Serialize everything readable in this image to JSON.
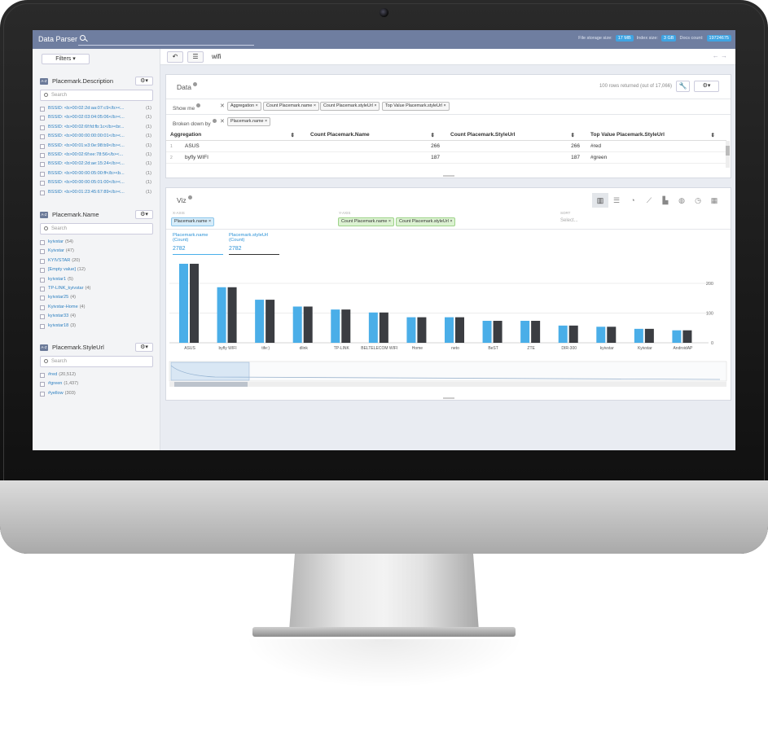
{
  "app": {
    "title": "Data Parser",
    "stats": [
      {
        "label": "File storage size:",
        "value": "17 MB"
      },
      {
        "label": "Index size:",
        "value": "3 GB"
      },
      {
        "label": "Docs count:",
        "value": "19724675"
      }
    ]
  },
  "sidebar": {
    "filters_label": "Filters ▾",
    "sections": [
      {
        "title": "Placemark.Description",
        "search_placeholder": "Search",
        "items": [
          {
            "label": "BSSID: <b>00:02:2d:aa:07:c9</b><...",
            "count": "(1)"
          },
          {
            "label": "BSSID: <b>00:02:03:04:05:06</b><...",
            "count": "(1)"
          },
          {
            "label": "BSSID: <b>00:02:6f:fd:fb:1c</b><br...",
            "count": "(1)"
          },
          {
            "label": "BSSID: <b>00:00:00:00:00:01</b><...",
            "count": "(1)"
          },
          {
            "label": "BSSID: <b>00:01:e3:0e:98:b9</b><...",
            "count": "(1)"
          },
          {
            "label": "BSSID: <b>00:02:6f:ee:78:56</b><...",
            "count": "(1)"
          },
          {
            "label": "BSSID: <b>00:02:2d:ae:15:24</b><...",
            "count": "(1)"
          },
          {
            "label": "BSSID: <b>00:00:00:05:00:ff</b><b...",
            "count": "(1)"
          },
          {
            "label": "BSSID: <b>00:00:00:05:01:00</b><...",
            "count": "(1)"
          },
          {
            "label": "BSSID: <b>00:01:23:45:67:89</b><...",
            "count": "(1)"
          }
        ]
      },
      {
        "title": "Placemark.Name",
        "search_placeholder": "Search",
        "items": [
          {
            "label": "kyivstar",
            "count": "(54)"
          },
          {
            "label": "Kyivstar",
            "count": "(47)"
          },
          {
            "label": "KYIVSTAR",
            "count": "(20)"
          },
          {
            "label": "[Empty value]",
            "count": "(12)"
          },
          {
            "label": "kyivstar1",
            "count": "(5)"
          },
          {
            "label": "TP-LINK_kyivstar",
            "count": "(4)"
          },
          {
            "label": "kyivstar25",
            "count": "(4)"
          },
          {
            "label": "Kyivstar-Home",
            "count": "(4)"
          },
          {
            "label": "kyivstar33",
            "count": "(4)"
          },
          {
            "label": "kyivstar18",
            "count": "(3)"
          }
        ]
      },
      {
        "title": "Placemark.StyleUrl",
        "search_placeholder": "Search",
        "items": [
          {
            "label": "#red",
            "count": "(20,512)"
          },
          {
            "label": "#green",
            "count": "(1,437)"
          },
          {
            "label": "#yellow",
            "count": "(303)"
          }
        ]
      }
    ]
  },
  "query": {
    "text": "wifi"
  },
  "data_panel": {
    "title": "Data",
    "rows_returned": "100 rows returned (out of 17,066)",
    "show_me_label": "Show me",
    "show_me_chips": [
      "Aggregation",
      "Count Placemark.name",
      "Count Placemark.styleUrl",
      "Top Value Placemark.styleUrl"
    ],
    "broken_down_label": "Broken down by",
    "broken_down_chips": [
      "Placemark.name"
    ],
    "columns": [
      "Aggregation",
      "Count Placemark.Name",
      "Count Placemark.StyleUrl",
      "Top Value Placemark.StyleUrl"
    ],
    "rows": [
      {
        "n": "1",
        "agg": "ASUS",
        "c1": "266",
        "c2": "266",
        "top": "#red"
      },
      {
        "n": "2",
        "agg": "byfly WIFI",
        "c1": "187",
        "c2": "187",
        "top": "#green"
      }
    ]
  },
  "viz_panel": {
    "title": "Viz",
    "x_axis_label": "X-AXIS",
    "y_axis_label": "Y-AXIS",
    "sort_label": "SORT",
    "sort_placeholder": "Select...",
    "x_chips": [
      "Placemark.name"
    ],
    "y_chips": [
      "Count Placemark.name",
      "Count Placemark.styleUrl"
    ],
    "series_tabs": [
      {
        "name": "Placemark.name (Count)",
        "value": "2782"
      },
      {
        "name": "Placemark.styleUrl (Count)",
        "value": "2782"
      }
    ],
    "icons": [
      "bar-chart-icon",
      "horizontal-bar-icon",
      "pie-chart-icon",
      "line-chart-icon",
      "area-chart-icon",
      "globe-icon",
      "clock-icon",
      "table-icon"
    ],
    "colors": {
      "series1": "#4aaee8",
      "series2": "#3b3d42"
    }
  },
  "chart_data": {
    "type": "bar",
    "categories": [
      "ASUS",
      "byfly WIFI",
      "tife:)",
      "dlink",
      "TP-LINK",
      "BELTELECOM WIFI",
      "Home",
      "neto",
      "BeST",
      "ZTE",
      "DIR-300",
      "kyivstar",
      "Kyivstar",
      "AndroidAP"
    ],
    "series": [
      {
        "name": "Placemark.name (Count)",
        "values": [
          266,
          187,
          145,
          122,
          112,
          102,
          86,
          86,
          74,
          74,
          58,
          54,
          47,
          42
        ]
      },
      {
        "name": "Placemark.styleUrl (Count)",
        "values": [
          266,
          187,
          145,
          122,
          112,
          102,
          86,
          86,
          74,
          74,
          58,
          54,
          47,
          42
        ]
      }
    ],
    "yticks": [
      0,
      100,
      200
    ],
    "ylim": [
      0,
      285
    ]
  }
}
